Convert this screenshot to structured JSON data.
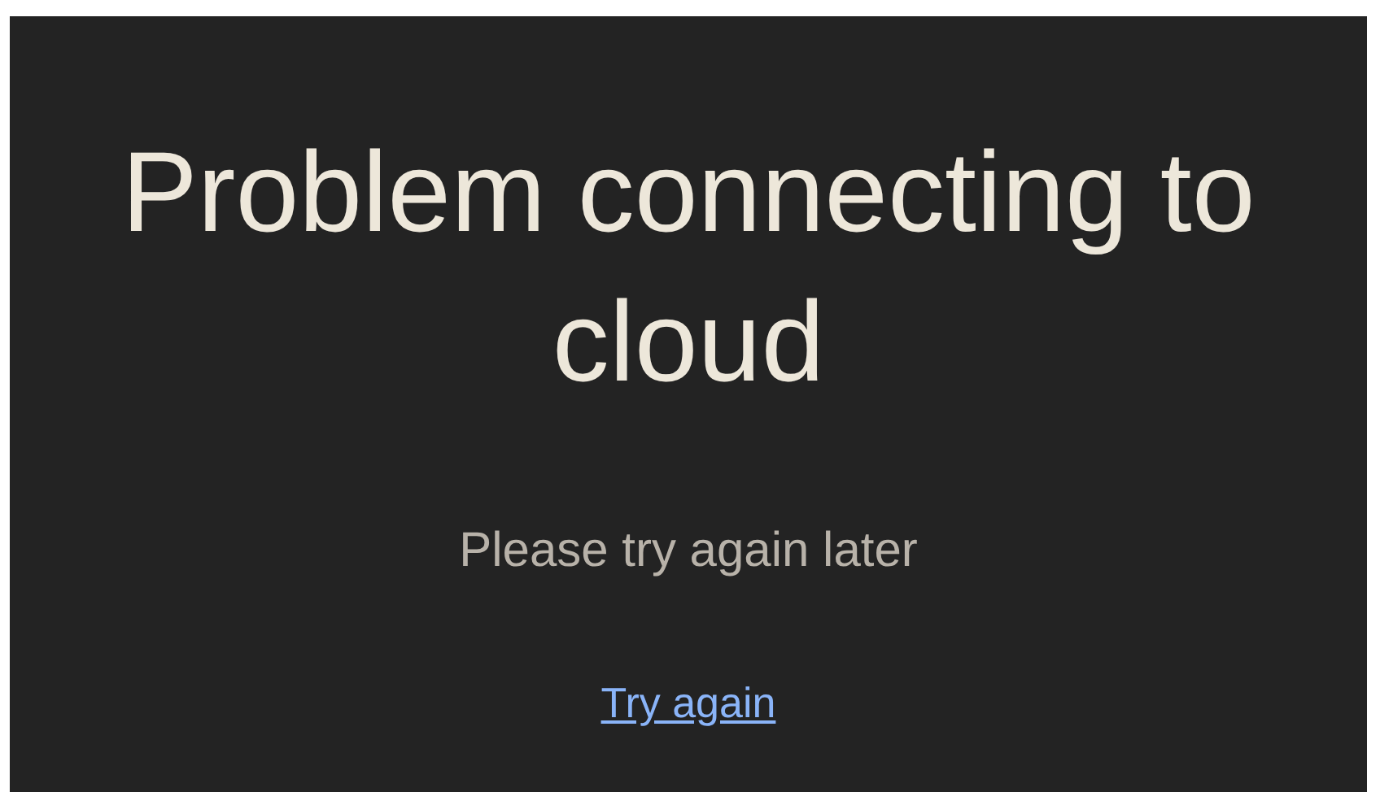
{
  "title": "Problem connecting to cloud",
  "message": "Please try again later",
  "link": "Try again"
}
